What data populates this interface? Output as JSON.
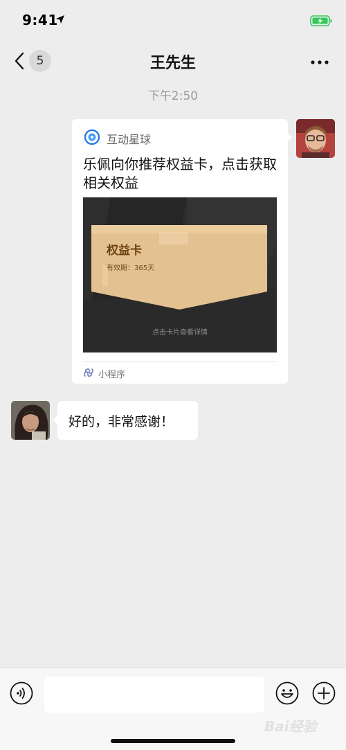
{
  "status": {
    "time": "9:41"
  },
  "nav": {
    "back_count": "5",
    "title": "王先生"
  },
  "chat": {
    "timestamp": "下午2:50"
  },
  "card": {
    "app_name": "互动星球",
    "title": "乐佩向你推荐权益卡，点击获取相关权益",
    "image": {
      "card_title": "权益卡",
      "validity": "有效期：365天",
      "hint": "点击卡片查看详情"
    },
    "footer_label": "小程序"
  },
  "reply": {
    "text": "好的，非常感谢！"
  },
  "input_bar": {
    "value": ""
  },
  "watermark": {
    "text": "Bai经验"
  },
  "colors": {
    "background": "#ededed",
    "bubble": "#ffffff",
    "gold": "#e4c190",
    "battery": "#34c759",
    "app_icon": "#1a73e8"
  }
}
